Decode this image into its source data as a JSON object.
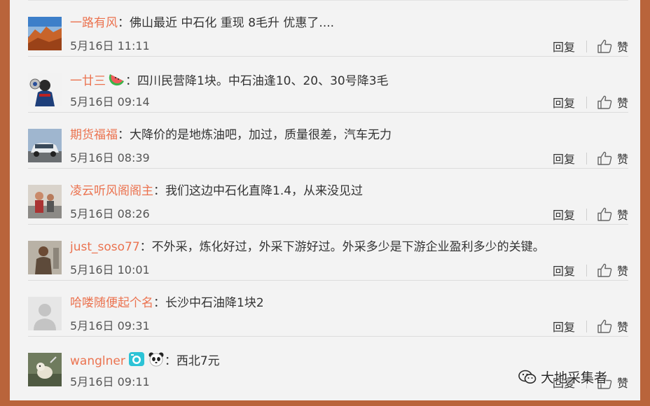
{
  "comments": [
    {
      "user": "一路有风",
      "text": "：佛山最近 中石化 重现 8毛升  优惠了....",
      "time": "5月16日 11:11",
      "avatar": "landscape"
    },
    {
      "user": "一廿三",
      "text": "：四川民营降1块。中石油逢10、20、30号降3毛",
      "time": "5月16日 09:14",
      "avatar": "superhero",
      "badges": [
        "watermelon-icon"
      ]
    },
    {
      "user": "期货福福",
      "text": "：大降价的是地炼油吧，加过，质量很差，汽车无力",
      "time": "5月16日 08:39",
      "avatar": "car"
    },
    {
      "user": "凌云听风阁阁主",
      "text": "：我们这边中石化直降1.4，从来没见过",
      "time": "5月16日 08:26",
      "avatar": "people"
    },
    {
      "user": "just_soso77",
      "text": "：不外采，炼化好过，外采下游好过。外采多少是下游企业盈利多少的关键。",
      "time": "5月16日 10:01",
      "avatar": "person"
    },
    {
      "user": "哈喽随便起个名",
      "text": "：长沙中石油降1块2",
      "time": "5月16日 09:31",
      "avatar": "default"
    },
    {
      "user": "wanglner",
      "text": "：西北7元",
      "time": "5月16日 09:11",
      "avatar": "dog",
      "badges": [
        "camera-badge-icon",
        "panda-icon"
      ]
    }
  ],
  "actions": {
    "reply": "回复",
    "like": "赞"
  },
  "watermark": "大地采集者",
  "colors": {
    "username": "#eb7350",
    "frame": "#b9643b",
    "background": "#f3f3f3"
  }
}
